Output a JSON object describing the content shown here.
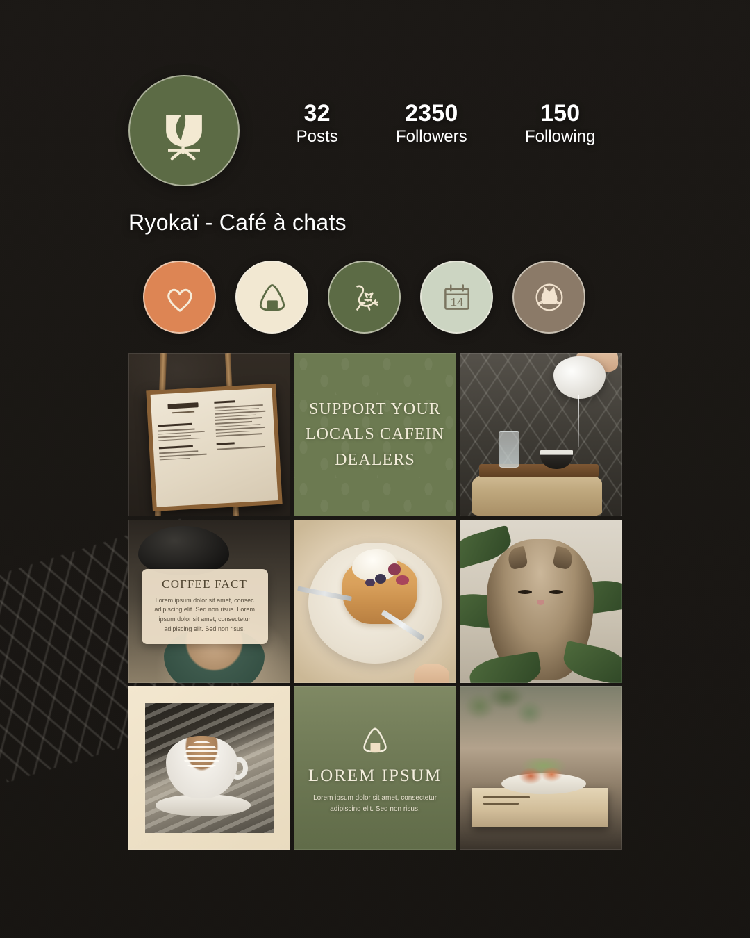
{
  "profile": {
    "avatar_icon": "leaf-cup-logo",
    "avatar_bg": "#5c6b45",
    "avatar_fg": "#f3e9d2",
    "username": "Ryokaï - Café à chats",
    "stats": [
      {
        "num": "32",
        "label": "Posts"
      },
      {
        "num": "2350",
        "label": "Followers"
      },
      {
        "num": "150",
        "label": "Following"
      }
    ]
  },
  "highlights": [
    {
      "name": "heart",
      "icon": "heart-icon",
      "bg": "#dd8554",
      "fg": "#f6ecd9"
    },
    {
      "name": "onigiri",
      "icon": "onigiri-icon",
      "bg": "#f2e8d2",
      "fg": "#5c6b45"
    },
    {
      "name": "cat-play",
      "icon": "cat-play-icon",
      "bg": "#5c6b45",
      "fg": "#f2e8d2"
    },
    {
      "name": "calendar",
      "icon": "calendar-icon",
      "bg": "#ccd5c2",
      "fg": "#7a7560"
    },
    {
      "name": "cat-face",
      "icon": "cat-face-icon",
      "bg": "#8b7a68",
      "fg": "#f2e3cf"
    }
  ],
  "posts": [
    {
      "id": "menu-board",
      "type": "photo",
      "alt": "Framed cafe menu board on wooden easel"
    },
    {
      "id": "support-quote",
      "type": "graphic",
      "lines": [
        "SUPPORT YOUR",
        "LOCALS CAFEIN",
        "DEALERS"
      ],
      "bg": "#6c7a51",
      "fg": "#f2ecd9"
    },
    {
      "id": "tea-pour",
      "type": "photo",
      "alt": "Pouring tea into a dark bowl on a wooden tray"
    },
    {
      "id": "coffee-fact",
      "type": "graphic",
      "title": "COFFEE FACT",
      "body": "Lorem ipsum dolor sit amet, consec adipiscing elit. Sed non risus. Lorem ipsum dolor sit amet, consectetur adipiscing elit. Sed non risus.",
      "card_bg": "#f0e2cb"
    },
    {
      "id": "pancakes",
      "type": "photo",
      "alt": "Pancake stack with cream and berries being cut"
    },
    {
      "id": "cat-plant",
      "type": "photo",
      "alt": "Fluffy tabby cat resting among plant leaves"
    },
    {
      "id": "latte-art",
      "type": "photo",
      "alt": "Latte with rosetta art in white cup, cream frame"
    },
    {
      "id": "lorem-ipsum",
      "type": "graphic",
      "icon": "onigiri-icon",
      "title": "LOREM IPSUM",
      "body": "Lorem ipsum dolor sit amet, consectetur adipiscing elit. Sed non risus.",
      "bg": "#6c7a51",
      "fg": "#f3eddc"
    },
    {
      "id": "salad-book",
      "type": "photo",
      "alt": "Salad plate served on a wooden book board"
    }
  ]
}
